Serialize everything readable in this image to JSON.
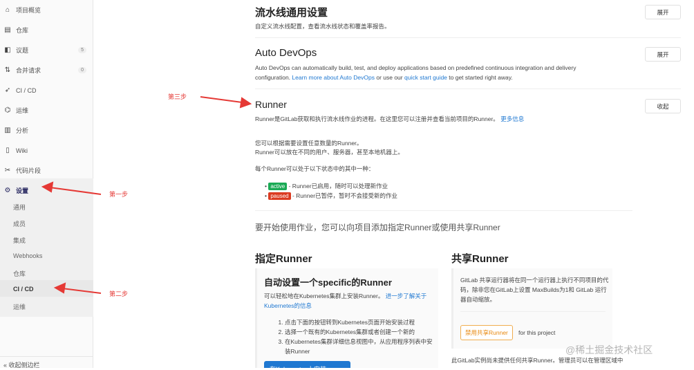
{
  "sidebar": {
    "items": [
      {
        "icon": "home-icon",
        "glyph": "⌂",
        "label": "项目概览"
      },
      {
        "icon": "repository-icon",
        "glyph": "▤",
        "label": "仓库"
      },
      {
        "icon": "issues-icon",
        "glyph": "◧",
        "label": "议题",
        "count": "5"
      },
      {
        "icon": "merge-request-icon",
        "glyph": "⇅",
        "label": "合并请求",
        "count": "0"
      },
      {
        "icon": "rocket-icon",
        "glyph": "➶",
        "label": "CI / CD"
      },
      {
        "icon": "operations-icon",
        "glyph": "⌬",
        "label": "运维"
      },
      {
        "icon": "analytics-icon",
        "glyph": "▥",
        "label": "分析"
      },
      {
        "icon": "wiki-icon",
        "glyph": "▯",
        "label": "Wiki"
      },
      {
        "icon": "snippets-icon",
        "glyph": "✂",
        "label": "代码片段"
      },
      {
        "icon": "gear-icon",
        "glyph": "⚙",
        "label": "设置"
      }
    ],
    "sub_items": [
      "通用",
      "成员",
      "集成",
      "Webhooks",
      "仓库",
      "CI / CD",
      "运维"
    ],
    "collapse": "收起侧边栏",
    "collapse_glyph": "«"
  },
  "annotations": {
    "step1": "第一步",
    "step2": "第二步",
    "step3": "第三步",
    "color": "#e53935"
  },
  "pipeline": {
    "title": "流水线通用设置",
    "desc": "自定义流水线配置，查看流水线状态和覆盖率报告。",
    "button": "展开"
  },
  "autodevops": {
    "title": "Auto DevOps",
    "desc1": "Auto DevOps can automatically build, test, and deploy applications based on predefined continuous integration and delivery configuration.",
    "link1": "Learn more about Auto DevOps",
    "mid": "or use our",
    "link2": "quick start guide",
    "end": "to get started right away.",
    "button": "展开"
  },
  "runner": {
    "title": "Runner",
    "desc": "Runner是GitLab获取和执行流水线作业的进程。在这里您可以注册并查看当前项目的Runner。",
    "more": "更多信息",
    "button": "收起",
    "p1": "您可以根据需要设置任意数量的Runner。",
    "p2": "Runner可以放在不同的用户、服务器，甚至本地机器上。",
    "p3": "每个Runner可以处于以下状态中的其中一种：",
    "states": [
      {
        "badge": "active",
        "color": "#1aaa55",
        "text": " - Runner已启用，随时可以处理新作业"
      },
      {
        "badge": "paused",
        "color": "#db3b21",
        "text": " - Runner已暂停，暂时不会接受新的作业"
      }
    ],
    "intro": "要开始使用作业，您可以向项目添加指定Runner或使用共享Runner"
  },
  "specific": {
    "title": "指定Runner",
    "card_title": "自动设置一个specific的Runner",
    "desc": "可以轻松地在Kubernetes集群上安装Runner。",
    "link": "进一步了解关于Kubernetes的信息",
    "steps": [
      "点击下面的按钮转到Kubernetes页面开始安装过程",
      "选择一个既有的Kubernetes集群或者创建一个新的",
      "在Kubernetes集群详细信息视图中，从应用程序列表中安装Runner"
    ],
    "button": "在Kubernetes上安装Runner"
  },
  "shared": {
    "title": "共享Runner",
    "desc": "GitLab 共享运行器将在同一个运行器上执行不同项目的代码，除非您在GitLab上设置 MaxBuilds为1和 GitLab 运行器自动缩放。",
    "button": "禁用共享Runner",
    "suffix": "for this project",
    "note": "此GitLab实例尚未提供任何共享Runner。管理员可以在管理区域中"
  },
  "watermark": "@稀土掘金技术社区"
}
